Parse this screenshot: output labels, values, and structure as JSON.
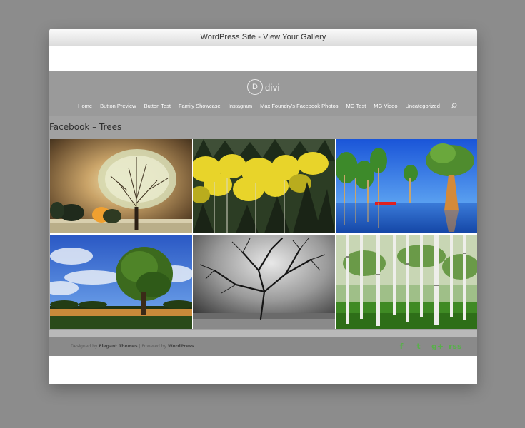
{
  "window": {
    "title": "WordPress Site - View Your Gallery"
  },
  "site": {
    "logo_letter": "D",
    "logo_text": "divi"
  },
  "nav": {
    "items": [
      {
        "label": "Home"
      },
      {
        "label": "Button Preview"
      },
      {
        "label": "Button Test"
      },
      {
        "label": "Family Showcase"
      },
      {
        "label": "Instagram"
      },
      {
        "label": "Max Foundry's Facebook Photos"
      },
      {
        "label": "MG Test"
      },
      {
        "label": "MG Video"
      },
      {
        "label": "Uncategorized"
      }
    ],
    "search_icon": "search-icon"
  },
  "page": {
    "title": "Facebook – Trees"
  },
  "gallery": {
    "images": [
      {
        "name": "tree-foggy-night-image"
      },
      {
        "name": "yellow-aspen-forest-image"
      },
      {
        "name": "cypress-swamp-image"
      },
      {
        "name": "tree-blue-sky-image"
      },
      {
        "name": "bare-tree-black-white-image"
      },
      {
        "name": "birch-forest-image"
      }
    ]
  },
  "footer": {
    "designed_by": "Designed by ",
    "designer": "Elegant Themes",
    "separator": " | Powered by ",
    "powered": "WordPress",
    "social": [
      {
        "name": "facebook-icon",
        "glyph": "f"
      },
      {
        "name": "twitter-icon",
        "glyph": "t"
      },
      {
        "name": "google-plus-icon",
        "glyph": "g+"
      },
      {
        "name": "rss-icon",
        "glyph": "rss"
      }
    ],
    "accent_color": "#58b04a"
  }
}
